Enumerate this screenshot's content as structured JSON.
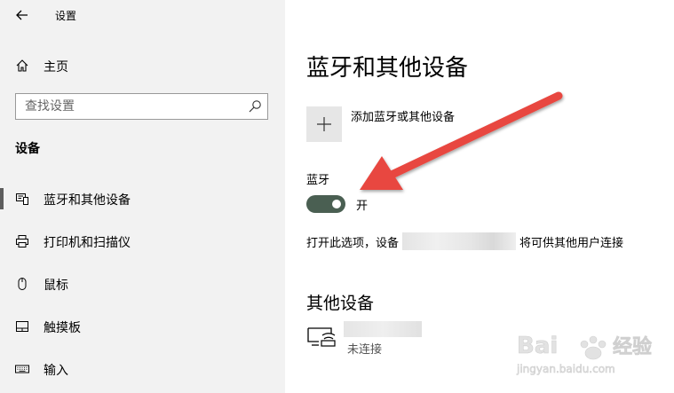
{
  "window": {
    "title": "设置"
  },
  "sidebar": {
    "home_label": "主页",
    "search_placeholder": "查找设置",
    "section_title": "设备",
    "items": [
      {
        "label": "蓝牙和其他设备",
        "icon": "bluetooth-devices-icon",
        "active": true
      },
      {
        "label": "打印机和扫描仪",
        "icon": "printer-icon",
        "active": false
      },
      {
        "label": "鼠标",
        "icon": "mouse-icon",
        "active": false
      },
      {
        "label": "触摸板",
        "icon": "touchpad-icon",
        "active": false
      },
      {
        "label": "输入",
        "icon": "keyboard-icon",
        "active": false
      }
    ]
  },
  "main": {
    "page_title": "蓝牙和其他设备",
    "add_device_label": "添加蓝牙或其他设备",
    "bluetooth_label": "蓝牙",
    "bluetooth_state": "开",
    "description_prefix": "打开此选项，设备",
    "description_suffix": "将可供其他用户连接",
    "other_devices_title": "其他设备",
    "device_status": "未连接"
  },
  "colors": {
    "sidebar_bg": "#f2f2f2",
    "toggle_on": "#4a5f52",
    "arrow": "#e8473f"
  }
}
